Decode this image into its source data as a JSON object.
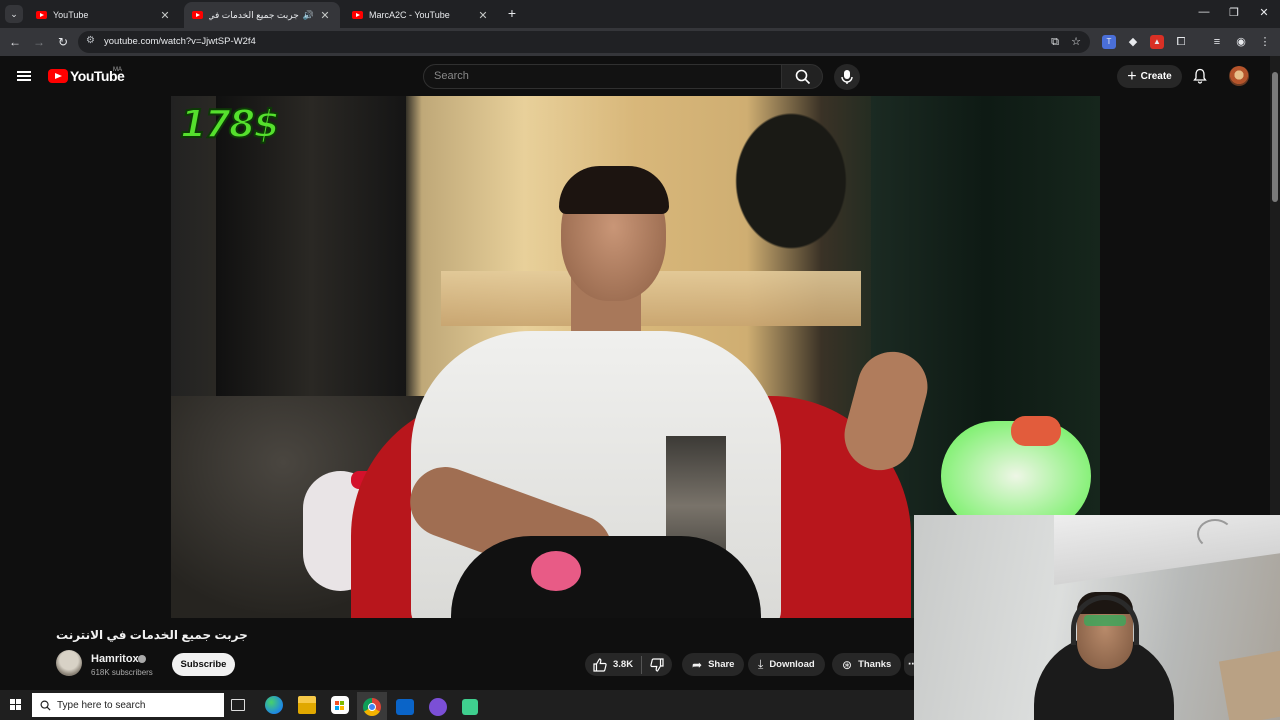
{
  "browser": {
    "tabs": [
      {
        "title": "YouTube",
        "active": false
      },
      {
        "title": "جربت جميع الخدمات في الانت",
        "active": true
      },
      {
        "title": "MarcA2C - YouTube",
        "active": false
      }
    ],
    "new_tab_glyph": "+",
    "close_glyph": "✕",
    "window_controls": {
      "minimize": "—",
      "restore": "❐",
      "close": "✕"
    },
    "url": "youtube.com/watch?v=JjwtSP-W2f4"
  },
  "youtube": {
    "logo_text": "YouTube",
    "country_code": "MA",
    "search_placeholder": "Search",
    "create_label": "Create"
  },
  "video": {
    "overlay_price": "178$",
    "title": "جربت جميع الخدمات في الانترنت",
    "channel_name": "Hamritox",
    "subscribers": "618K subscribers",
    "subscribe_label": "Subscribe",
    "likes": "3.8K",
    "share_label": "Share",
    "download_label": "Download",
    "thanks_label": "Thanks"
  },
  "taskbar": {
    "search_placeholder": "Type here to search"
  },
  "colors": {
    "yt_red": "#ff0000",
    "bg": "#0f0f0f",
    "chip": "#272727"
  }
}
